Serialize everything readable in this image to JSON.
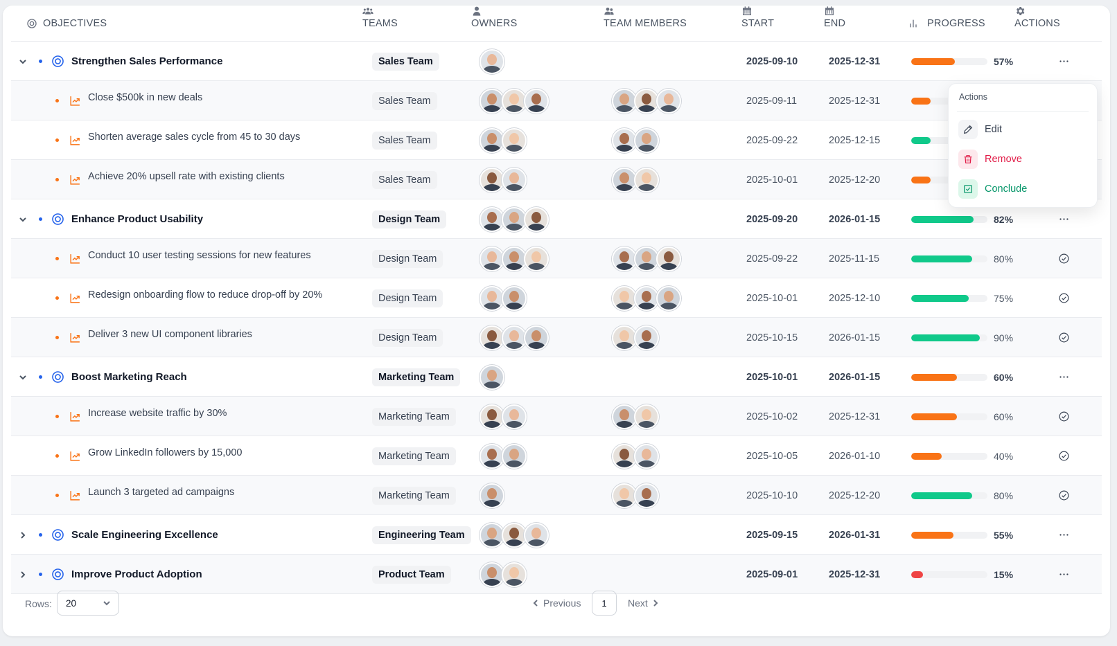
{
  "header": {
    "objectives": "OBJECTIVES",
    "teams": "TEAMS",
    "owners": "OWNERS",
    "team_members": "TEAM MEMBERS",
    "start": "START",
    "end": "END",
    "progress": "PROGRESS",
    "actions": "ACTIONS"
  },
  "colors": {
    "accent_blue": "#2563eb",
    "orange": "#f97316",
    "green": "#10c98a",
    "red": "#ef4444"
  },
  "rows": [
    {
      "level": "parent",
      "expanded": true,
      "title": "Strengthen Sales Performance",
      "team": "Sales Team",
      "owners": 1,
      "members": 0,
      "start": "2025-09-10",
      "end": "2025-12-31",
      "progress": 57,
      "progress_label": "57%",
      "status": "orange",
      "action": "more"
    },
    {
      "level": "child",
      "title": "Close $500k in new deals",
      "team": "Sales Team",
      "owners": 3,
      "members": 3,
      "start": "2025-09-11",
      "end": "2025-12-31",
      "progress": 25,
      "progress_label": "",
      "status": "orange",
      "action": "none"
    },
    {
      "level": "child",
      "title": "Shorten average sales cycle from 45 to 30 days",
      "team": "Sales Team",
      "owners": 2,
      "members": 2,
      "start": "2025-09-22",
      "end": "2025-12-15",
      "progress": 25,
      "progress_label": "",
      "status": "green",
      "action": "none"
    },
    {
      "level": "child",
      "title": "Achieve 20% upsell rate with existing clients",
      "team": "Sales Team",
      "owners": 2,
      "members": 2,
      "start": "2025-10-01",
      "end": "2025-12-20",
      "progress": 25,
      "progress_label": "",
      "status": "orange",
      "action": "none"
    },
    {
      "level": "parent",
      "expanded": true,
      "title": "Enhance Product Usability",
      "team": "Design Team",
      "owners": 3,
      "members": 0,
      "start": "2025-09-20",
      "end": "2026-01-15",
      "progress": 82,
      "progress_label": "82%",
      "status": "green",
      "action": "more"
    },
    {
      "level": "child",
      "title": "Conduct 10 user testing sessions for new features",
      "team": "Design Team",
      "owners": 3,
      "members": 3,
      "start": "2025-09-22",
      "end": "2025-11-15",
      "progress": 80,
      "progress_label": "80%",
      "status": "green",
      "action": "check"
    },
    {
      "level": "child",
      "title": "Redesign onboarding flow to reduce drop-off by 20%",
      "team": "Design Team",
      "owners": 2,
      "members": 3,
      "start": "2025-10-01",
      "end": "2025-12-10",
      "progress": 75,
      "progress_label": "75%",
      "status": "green",
      "action": "check"
    },
    {
      "level": "child",
      "title": "Deliver 3 new UI component libraries",
      "team": "Design Team",
      "owners": 3,
      "members": 2,
      "start": "2025-10-15",
      "end": "2026-01-15",
      "progress": 90,
      "progress_label": "90%",
      "status": "green",
      "action": "check"
    },
    {
      "level": "parent",
      "expanded": true,
      "title": "Boost Marketing Reach",
      "team": "Marketing Team",
      "owners": 1,
      "members": 0,
      "start": "2025-10-01",
      "end": "2026-01-15",
      "progress": 60,
      "progress_label": "60%",
      "status": "orange",
      "action": "more"
    },
    {
      "level": "child",
      "title": "Increase website traffic by 30%",
      "team": "Marketing Team",
      "owners": 2,
      "members": 2,
      "start": "2025-10-02",
      "end": "2025-12-31",
      "progress": 60,
      "progress_label": "60%",
      "status": "orange",
      "action": "check"
    },
    {
      "level": "child",
      "title": "Grow LinkedIn followers by 15,000",
      "team": "Marketing Team",
      "owners": 2,
      "members": 2,
      "start": "2025-10-05",
      "end": "2026-01-10",
      "progress": 40,
      "progress_label": "40%",
      "status": "orange",
      "action": "check"
    },
    {
      "level": "child",
      "title": "Launch 3 targeted ad campaigns",
      "team": "Marketing Team",
      "owners": 1,
      "members": 2,
      "start": "2025-10-10",
      "end": "2025-12-20",
      "progress": 80,
      "progress_label": "80%",
      "status": "green",
      "action": "check"
    },
    {
      "level": "parent",
      "expanded": false,
      "title": "Scale Engineering Excellence",
      "team": "Engineering Team",
      "owners": 3,
      "members": 0,
      "start": "2025-09-15",
      "end": "2026-01-31",
      "progress": 55,
      "progress_label": "55%",
      "status": "orange",
      "action": "more"
    },
    {
      "level": "parent",
      "expanded": false,
      "title": "Improve Product Adoption",
      "team": "Product Team",
      "owners": 2,
      "members": 0,
      "start": "2025-09-01",
      "end": "2025-12-31",
      "progress": 15,
      "progress_label": "15%",
      "status": "red",
      "action": "more"
    }
  ],
  "action_menu": {
    "title": "Actions",
    "items": [
      {
        "label": "Edit",
        "icon": "pencil-icon",
        "color": "#374151"
      },
      {
        "label": "Remove",
        "icon": "trash-icon",
        "color": "#e11d48"
      },
      {
        "label": "Conclude",
        "icon": "check-square-icon",
        "color": "#059669"
      }
    ]
  },
  "footer": {
    "rows_label": "Rows:",
    "rows_value": "20",
    "previous": "Previous",
    "page": "1",
    "next": "Next"
  }
}
